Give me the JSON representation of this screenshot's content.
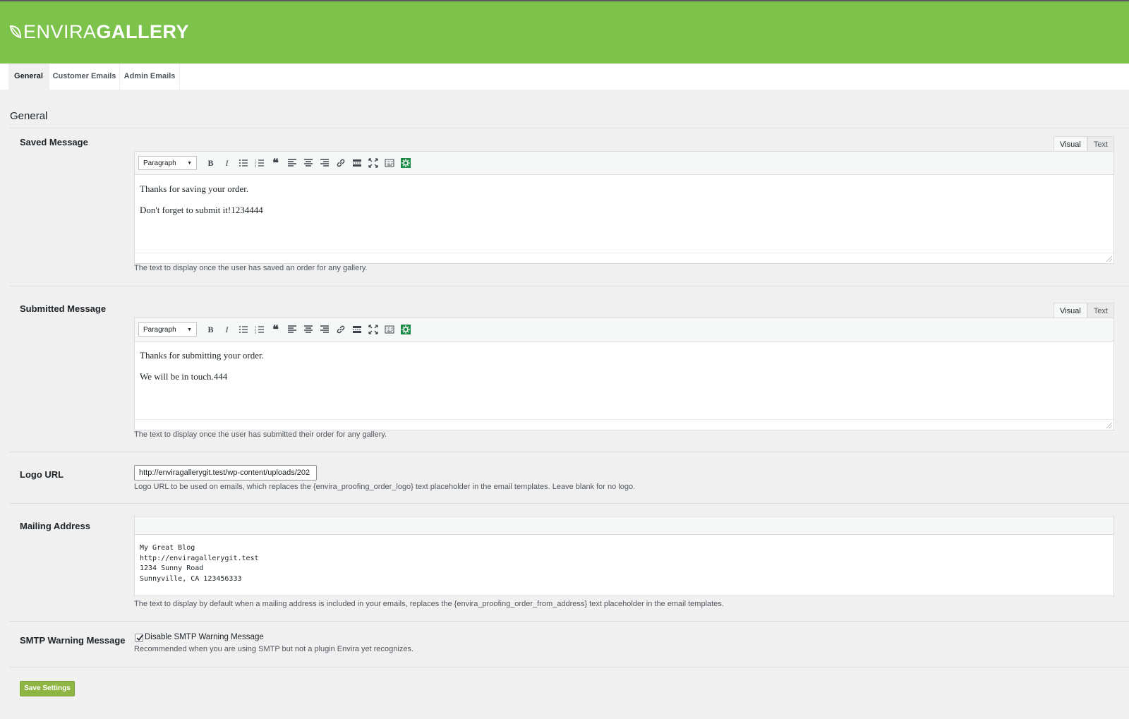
{
  "brand": {
    "logo_light": "ENVIRA",
    "logo_bold": "GALLERY",
    "header_color": "#7cc24b"
  },
  "tabs": [
    {
      "label": "General",
      "active": true
    },
    {
      "label": "Customer Emails",
      "active": false
    },
    {
      "label": "Admin Emails",
      "active": false
    }
  ],
  "section_title": "General",
  "saved_message": {
    "label": "Saved Message",
    "mode_visual": "Visual",
    "mode_text": "Text",
    "format": "Paragraph",
    "lines": [
      "Thanks for saving your order.",
      "Don't forget to submit it!1234444"
    ],
    "description": "The text to display once the user has saved an order for any gallery."
  },
  "submitted_message": {
    "label": "Submitted Message",
    "mode_visual": "Visual",
    "mode_text": "Text",
    "format": "Paragraph",
    "lines": [
      "Thanks for submitting your order.",
      "We will be in touch.444"
    ],
    "description": "The text to display once the user has submitted their order for any gallery."
  },
  "logo_url": {
    "label": "Logo URL",
    "value": "http://enviragallerygit.test/wp-content/uploads/202",
    "description": "Logo URL to be used on emails, which replaces the {envira_proofing_order_logo} text placeholder in the email templates. Leave blank for no logo."
  },
  "mailing_address": {
    "label": "Mailing Address",
    "value": "My Great Blog\nhttp://enviragallerygit.test\n1234 Sunny Road\nSunnyville, CA 123456333",
    "description": "The text to display by default when a mailing address is included in your emails, replaces the {envira_proofing_order_from_address} text placeholder in the email templates."
  },
  "smtp": {
    "label": "SMTP Warning Message",
    "checkbox_label": "Disable SMTP Warning Message",
    "checked": true,
    "description": "Recommended when you are using SMTP but not a plugin Envira yet recognizes."
  },
  "save_button": "Save Settings",
  "accent_color": "#8fb542",
  "icons": [
    "bold-icon",
    "italic-icon",
    "bullet-list-icon",
    "numbered-list-icon",
    "blockquote-icon",
    "align-left-icon",
    "align-center-icon",
    "align-right-icon",
    "link-icon",
    "read-more-icon",
    "fullscreen-icon",
    "toolbar-toggle-icon",
    "envira-gear-icon"
  ]
}
